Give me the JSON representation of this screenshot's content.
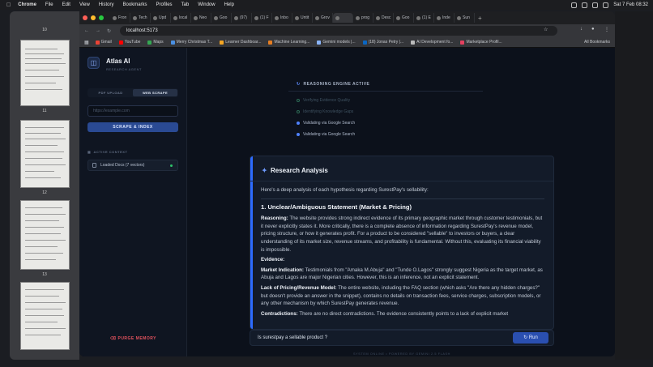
{
  "menubar": {
    "app": "Chrome",
    "items": [
      "File",
      "Edit",
      "View",
      "History",
      "Bookmarks",
      "Profiles",
      "Tab",
      "Window",
      "Help"
    ],
    "clock": "Sat 7 Feb  08:32"
  },
  "pdf": {
    "pages": [
      "10",
      "11",
      "12",
      "13"
    ]
  },
  "tabs": [
    "Fron",
    "Tech",
    "Upd",
    "local",
    "Neo",
    "Goo",
    "(97)",
    "(1) F",
    "Inbo",
    "Untit",
    "Grov",
    "",
    "prog",
    "Desc",
    "Goo",
    "(1) E",
    "Inde",
    "Sun"
  ],
  "address": {
    "url": "localhost:5173"
  },
  "bookmarks": [
    "Gmail",
    "YouTube",
    "Maps",
    "Merry Christmas T...",
    "Learner Dashboar...",
    "Machine Learning...",
    "Gemini models |...",
    "(18) Jonas Petry |...",
    "AI Development fo...",
    "Marketplace Profil..."
  ],
  "all_bookmarks": "All Bookmarks",
  "colors": {
    "accent": "#2d6bff",
    "danger": "#e2525d",
    "success": "#2ec26b"
  },
  "sidebar": {
    "title": "Atlas AI",
    "subtitle": "RESEARCH AGENT",
    "tab_pdf": "PDF UPLOAD",
    "tab_web": "WEB SCRAPE",
    "url_placeholder": "https://example.com",
    "scrape_button": "SCRAPE & INDEX",
    "context_header": "ACTIVE CONTEXT",
    "context_item": "Loaded Docs (7 vectors)",
    "purge": "PURGE MEMORY"
  },
  "engine": {
    "header": "REASONING ENGINE ACTIVE",
    "steps": [
      "Verifying Evidence Quality",
      "Identifying Knowledge Gaps",
      "Validating via Google Search",
      "Validating via Google Search"
    ]
  },
  "analysis": {
    "title": "Research Analysis",
    "intro": "Here's a deep analysis of each hypothesis regarding SurestPay's sellability:",
    "heading": "1. Unclear/Ambiguous Statement (Market & Pricing)",
    "reasoning_label": "Reasoning:",
    "reasoning": "The website provides strong indirect evidence of its primary geographic market through customer testimonials, but it never explicitly states it. More critically, there is a complete absence of information regarding SurestPay's revenue model, pricing structure, or how it generates profit. For a product to be considered \"sellable\" to investors or buyers, a clear understanding of its market size, revenue streams, and profitability is fundamental. Without this, evaluating its financial viability is impossible.",
    "evidence_label": "Evidence:",
    "market_label": "Market Indication:",
    "market": "Testimonials from \"Amaka M.Abuja\" and \"Tunde O.Lagos\" strongly suggest Nigeria as the target market, as Abuja and Lagos are major Nigerian cities. However, this is an inference, not an explicit statement.",
    "pricing_label": "Lack of Pricing/Revenue Model:",
    "pricing": "The entire website, including the FAQ section (which asks \"Are there any hidden charges?\" but doesn't provide an answer in the snippet), contains no details on transaction fees, service charges, subscription models, or any other mechanism by which SurestPay generates revenue.",
    "contra_label": "Contradictions:",
    "contra": "There are no direct contradictions. The evidence consistently points to a lack of explicit market"
  },
  "query": {
    "value": "Is surestpay a sellable product ?",
    "run": "Run"
  },
  "footer": "SYSTEM ONLINE • POWERED BY GEMINI 2.5 FLASH"
}
